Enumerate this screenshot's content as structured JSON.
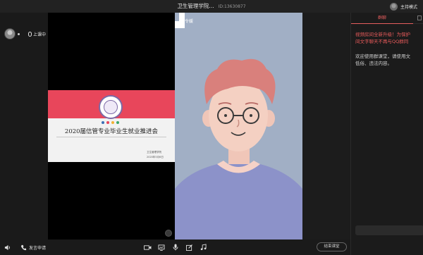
{
  "window": {
    "title": "卫生管理学院...",
    "room_id": "ID:13630877"
  },
  "host": {
    "mode_label": "主持模式",
    "avatar_icon": "avatar-icon"
  },
  "participant": {
    "status_label": "上课中"
  },
  "slide": {
    "title": "2020届信管专业毕业生就业推进会",
    "org": "卫生管理学院",
    "date": "2020年5月6日",
    "band_color": "#e8465b",
    "dot_colors": [
      "#3b6fb6",
      "#e8465b",
      "#f2b233",
      "#3aa76d"
    ]
  },
  "video": {
    "name": "孔令媛",
    "background_color": "#a1afc5"
  },
  "sidebar": {
    "tab_label": "群聊",
    "notice_line1": "视频房间全新升级！为保护",
    "notice_line2": "间文字聊天不再与QQ群同",
    "welcome_line1": "欢迎使用群课堂，请使用文",
    "welcome_line2": "低俗、违法内容。"
  },
  "bottombar": {
    "speak_request_label": "发言申请",
    "end_class_label": "结束课堂",
    "icons": [
      "volume-icon",
      "phone-icon",
      "camera-icon",
      "screen-share-icon",
      "mic-icon",
      "edit-icon",
      "music-icon"
    ]
  }
}
